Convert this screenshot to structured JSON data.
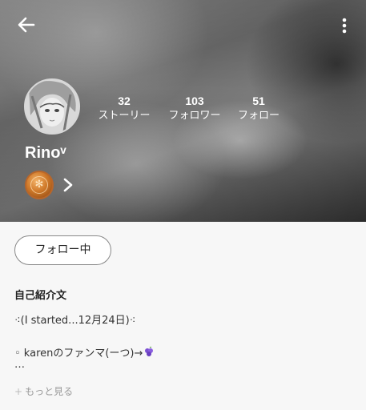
{
  "header": {
    "back_icon": "arrow-left-icon",
    "more_icon": "more-vertical-icon"
  },
  "profile": {
    "username": "Rinoᵛ",
    "avatar_desc": "avatar",
    "stats": [
      {
        "count": "32",
        "label": "ストーリー"
      },
      {
        "count": "103",
        "label": "フォロワー"
      },
      {
        "count": "51",
        "label": "フォロー"
      }
    ],
    "coin_icon": "coin-badge-icon"
  },
  "actions": {
    "follow_label": "フォロー中"
  },
  "bio": {
    "title": "自己紹介文",
    "line1": "⁖(I started...12月24日)⁖",
    "line2": "◦ karenのファンマ(ーつ)→",
    "line3": "…",
    "see_more": "もっと見る"
  },
  "colors": {
    "text_dark": "#222222",
    "muted": "#999999",
    "background": "#f7f7f7"
  }
}
